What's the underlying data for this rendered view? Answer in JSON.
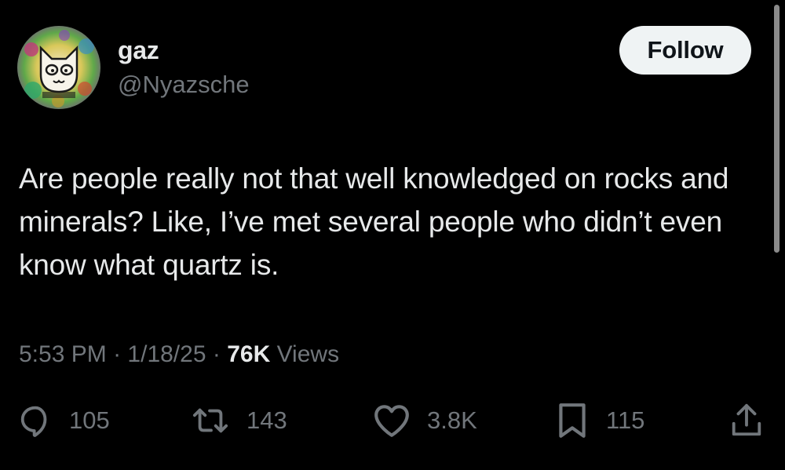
{
  "author": {
    "display_name": "gaz",
    "handle": "@Nyazsche",
    "avatar_icon": "cat-avatar-icon"
  },
  "follow_button": {
    "label": "Follow"
  },
  "tweet": {
    "text": "Are people really not that well knowledged on rocks and minerals? Like, I’ve met several people who didn’t even know what quartz is."
  },
  "meta": {
    "time": "5:53 PM",
    "separator": "·",
    "date": "1/18/25",
    "views_count": "76K",
    "views_label": "Views"
  },
  "actions": {
    "replies": {
      "icon": "reply-icon",
      "count": "105"
    },
    "retweets": {
      "icon": "retweet-icon",
      "count": "143"
    },
    "likes": {
      "icon": "heart-icon",
      "count": "3.8K"
    },
    "bookmarks": {
      "icon": "bookmark-icon",
      "count": "115"
    },
    "share": {
      "icon": "share-icon"
    }
  },
  "colors": {
    "background": "#000000",
    "primary_text": "#e7e9ea",
    "secondary_text": "#71767b",
    "follow_bg": "#eff3f4",
    "follow_text": "#0f1419"
  }
}
